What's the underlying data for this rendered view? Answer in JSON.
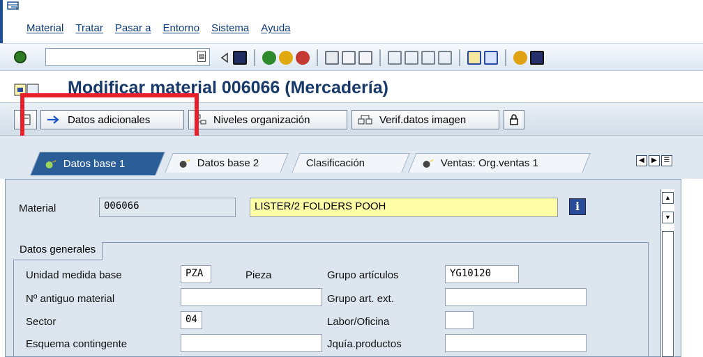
{
  "menu": {
    "items": [
      "Material",
      "Tratar",
      "Pasar a",
      "Entorno",
      "Sistema",
      "Ayuda"
    ]
  },
  "toolbar": {
    "command_value": "",
    "icons": [
      "enter-icon",
      "dropdown-icon",
      "back-icon",
      "save-icon",
      "back-nav-icon",
      "exit-icon",
      "cancel-icon",
      "print-icon",
      "find-icon",
      "find-next-icon",
      "first-page-icon",
      "previous-page-icon",
      "next-page-icon",
      "last-page-icon",
      "new-session-icon",
      "shortcut-icon",
      "help-icon",
      "layout-icon"
    ]
  },
  "title": {
    "text": "Modificar material 006066 (Mercadería)"
  },
  "app_toolbar": {
    "buttons": [
      "Datos adicionales",
      "Niveles organización",
      "Verif.datos imagen"
    ]
  },
  "tabs": [
    {
      "label": "Datos base 1",
      "active": true
    },
    {
      "label": "Datos base 2",
      "active": false
    },
    {
      "label": "Clasificación",
      "active": false
    },
    {
      "label": "Ventas: Org.ventas 1",
      "active": false
    }
  ],
  "header_fields": {
    "material_label": "Material",
    "material_value": "006066",
    "description_value": "LISTER/2 FOLDERS POOH",
    "info_glyph": "i"
  },
  "group": {
    "title": "Datos generales",
    "rows": [
      {
        "label": "Unidad medida base",
        "value": "PZA",
        "text": "Pieza",
        "right_label": "Grupo artículos",
        "right_value": "YG10120"
      },
      {
        "label": "Nº antiguo material",
        "value": "",
        "text": "",
        "right_label": "Grupo art. ext.",
        "right_value": ""
      },
      {
        "label": "Sector",
        "value": "04",
        "text": "",
        "right_label": "Labor/Oficina",
        "right_value": ""
      },
      {
        "label": "Esquema contingente",
        "value": "",
        "text": "",
        "right_label": "Jquía.productos",
        "right_value": ""
      }
    ]
  },
  "colors": {
    "title": "#183a6a",
    "active_tab": "#2b5d97",
    "highlight_box": "#e8202b",
    "description_field": "#ffffa8"
  }
}
